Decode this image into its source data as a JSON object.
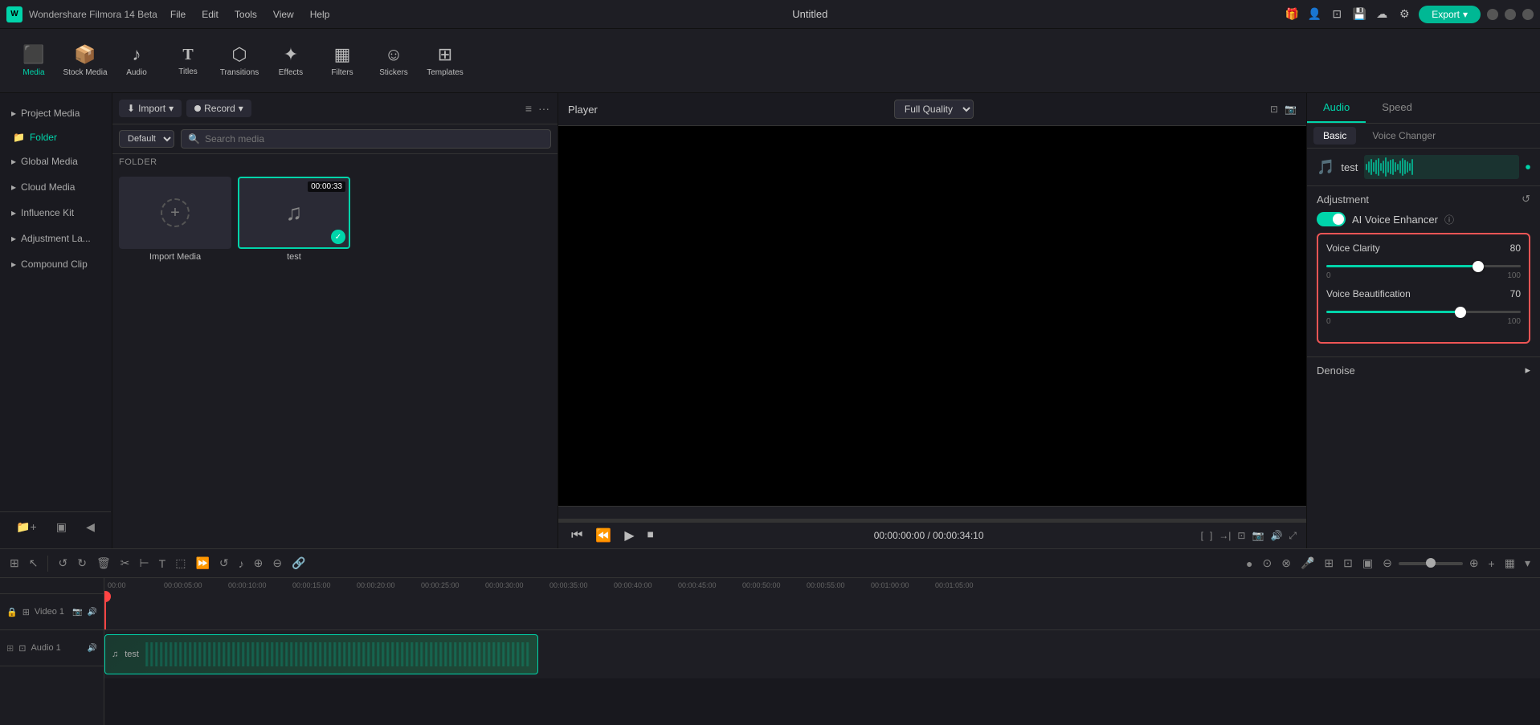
{
  "app": {
    "title": "Wondershare Filmora 14 Beta",
    "project_title": "Untitled"
  },
  "titlebar": {
    "menus": [
      "File",
      "Edit",
      "Tools",
      "View",
      "Help"
    ],
    "export_label": "Export"
  },
  "toolbar": {
    "items": [
      {
        "id": "media",
        "label": "Media",
        "icon": "🎬",
        "active": true
      },
      {
        "id": "stock_media",
        "label": "Stock Media",
        "icon": "📦"
      },
      {
        "id": "audio",
        "label": "Audio",
        "icon": "🎵"
      },
      {
        "id": "titles",
        "label": "Titles",
        "icon": "T"
      },
      {
        "id": "transitions",
        "label": "Transitions",
        "icon": "⬡"
      },
      {
        "id": "effects",
        "label": "Effects",
        "icon": "✦"
      },
      {
        "id": "filters",
        "label": "Filters",
        "icon": "🔲"
      },
      {
        "id": "stickers",
        "label": "Stickers",
        "icon": "😊"
      },
      {
        "id": "templates",
        "label": "Templates",
        "icon": "⊞"
      }
    ]
  },
  "left_panel": {
    "nav_items": [
      {
        "label": "Project Media",
        "has_arrow": true
      },
      {
        "label": "Folder",
        "is_folder": true
      },
      {
        "label": "Global Media",
        "has_arrow": true
      },
      {
        "label": "Cloud Media",
        "has_arrow": true
      },
      {
        "label": "Influence Kit",
        "has_arrow": true
      },
      {
        "label": "Adjustment La...",
        "has_arrow": true
      },
      {
        "label": "Compound Clip",
        "has_arrow": true
      }
    ]
  },
  "media_panel": {
    "import_label": "Import",
    "record_label": "Record",
    "view_label": "Default",
    "search_placeholder": "Search media",
    "folder_label": "FOLDER",
    "items": [
      {
        "type": "add",
        "label": "Import Media"
      },
      {
        "type": "audio",
        "label": "test",
        "duration": "00:00:33",
        "selected": true,
        "checked": true
      }
    ]
  },
  "preview": {
    "player_label": "Player",
    "quality_label": "Full Quality",
    "current_time": "00:00:00:00",
    "total_time": "00:00:34:10"
  },
  "right_panel": {
    "tabs": [
      "Audio",
      "Speed"
    ],
    "active_tab": "Audio",
    "subtabs": [
      "Basic",
      "Voice Changer"
    ],
    "active_subtab": "Basic",
    "audio_file": {
      "name": "test",
      "icon": "🎵"
    },
    "adjustment": {
      "title": "Adjustment",
      "ai_voice_enhancer_label": "AI Voice Enhancer",
      "ai_voice_enhancer_enabled": true
    },
    "voice_clarity": {
      "label": "Voice Clarity",
      "value": 80,
      "min": 0,
      "max": 100,
      "percent": 80
    },
    "voice_beautification": {
      "label": "Voice Beautification",
      "value": 70,
      "min": 0,
      "max": 100,
      "percent": 70
    },
    "denoise": {
      "label": "Denoise"
    }
  },
  "timeline": {
    "tracks": [
      {
        "name": "Video 1",
        "type": "video"
      },
      {
        "name": "Audio 1",
        "type": "audio"
      }
    ],
    "scale_marks": [
      "00:00",
      "00:00:05:00",
      "00:00:10:00",
      "00:00:15:00",
      "00:00:20:00",
      "00:00:25:00",
      "00:00:30:00",
      "00:00:35:00",
      "00:00:40:00",
      "00:00:45:00",
      "00:00:50:00",
      "00:00:55:00",
      "00:01:00:00",
      "00:01:05:00"
    ],
    "audio_clip_label": "test"
  }
}
